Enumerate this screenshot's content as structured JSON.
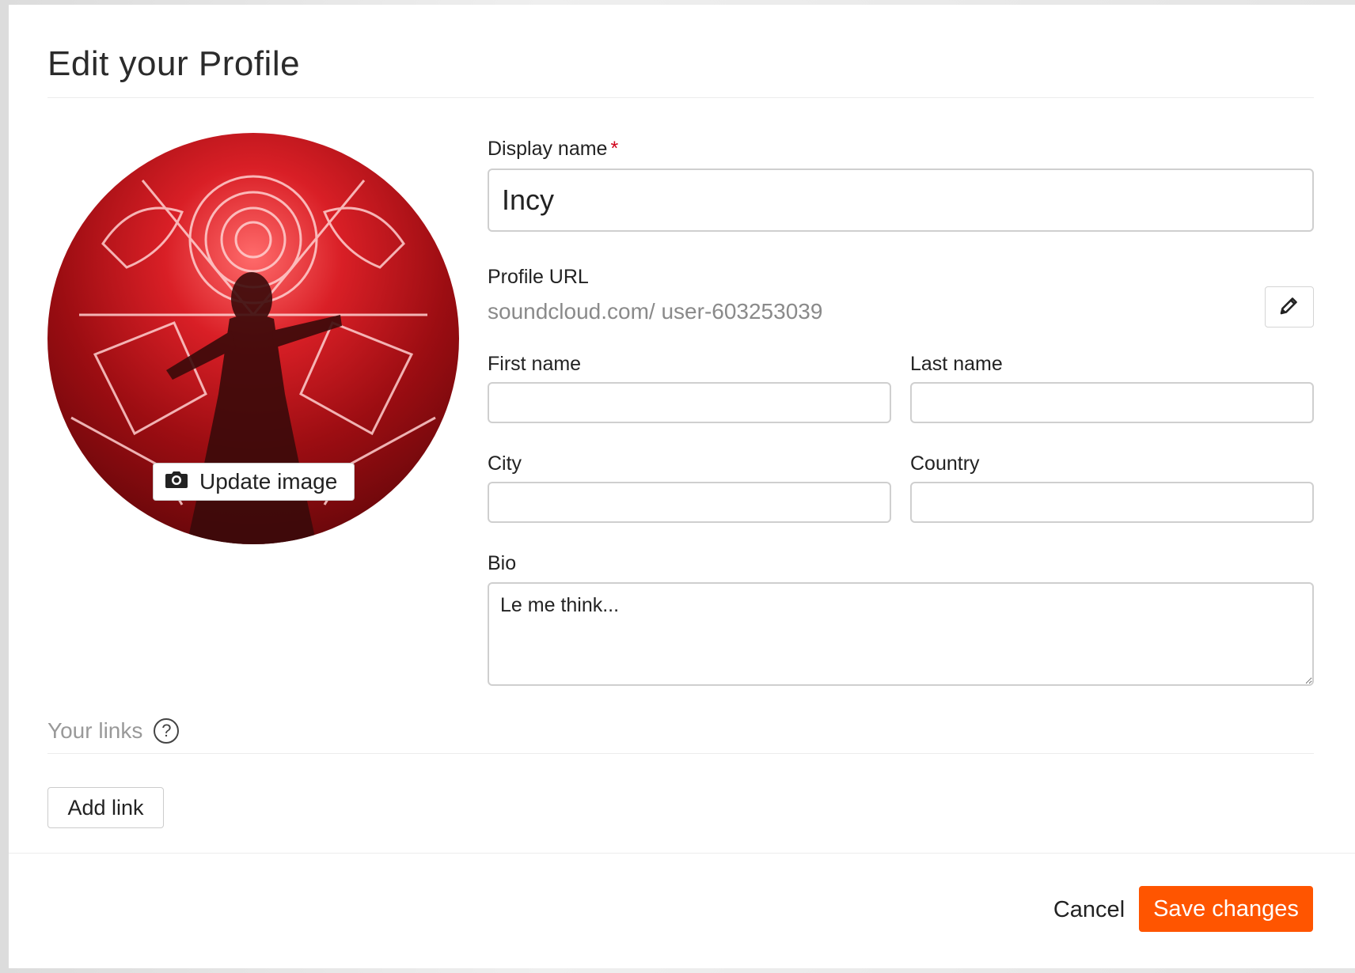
{
  "dialog": {
    "title": "Edit your Profile"
  },
  "avatar": {
    "update_label": "Update image",
    "camera_icon": "camera-icon"
  },
  "form": {
    "display_name_label": "Display name",
    "display_name_required": "*",
    "display_name_value": "Incy",
    "profile_url_label": "Profile URL",
    "profile_url_prefix": "soundcloud.com/",
    "profile_url_slug": "user-603253039",
    "edit_url_icon": "pencil-icon",
    "first_name_label": "First name",
    "first_name_value": "",
    "last_name_label": "Last name",
    "last_name_value": "",
    "city_label": "City",
    "city_value": "",
    "country_label": "Country",
    "country_value": "",
    "bio_label": "Bio",
    "bio_value": "Le me think..."
  },
  "links": {
    "title": "Your links",
    "help_icon": "help-icon",
    "help_glyph": "?",
    "add_link_label": "Add link"
  },
  "footer": {
    "cancel_label": "Cancel",
    "save_label": "Save changes"
  },
  "colors": {
    "accent": "#ff5500",
    "required": "#d0021b"
  }
}
